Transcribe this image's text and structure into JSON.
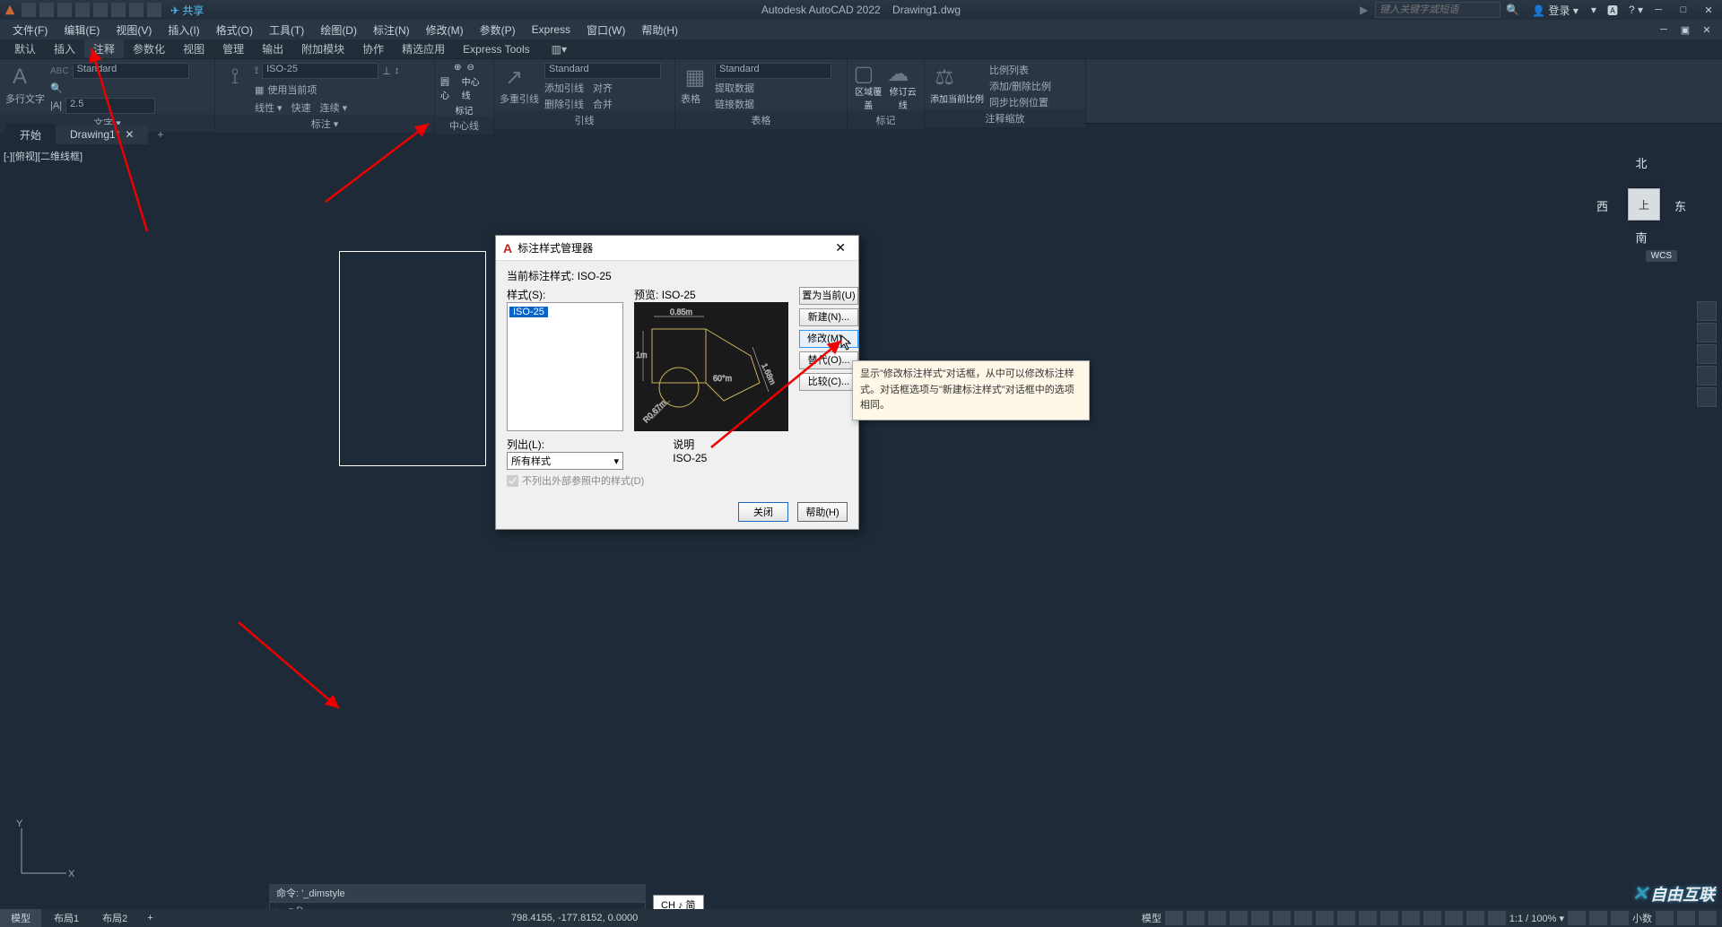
{
  "app": {
    "title": "Autodesk AutoCAD 2022",
    "file": "Drawing1.dwg",
    "share": "共享"
  },
  "search": {
    "placeholder": "键入关键字或短语",
    "login": "登录"
  },
  "menu": [
    "文件(F)",
    "编辑(E)",
    "视图(V)",
    "插入(I)",
    "格式(O)",
    "工具(T)",
    "绘图(D)",
    "标注(N)",
    "修改(M)",
    "参数(P)",
    "Express",
    "窗口(W)",
    "帮助(H)"
  ],
  "tabs": [
    "默认",
    "插入",
    "注释",
    "参数化",
    "视图",
    "管理",
    "输出",
    "附加模块",
    "协作",
    "精选应用",
    "Express Tools"
  ],
  "ribbon": {
    "text": {
      "big": "A",
      "label": "多行文字",
      "sel": "Standard",
      "num": "2.5",
      "panel": "文字 ▾"
    },
    "dim": {
      "sel": "ISO-25",
      "opt1": "使用当前项",
      "opt2": "线性 ▾",
      "opt3": "快速",
      "opt4": "连续 ▾",
      "panel": "标注 ▾"
    },
    "center": {
      "l1": "圆心",
      "l2": "标记",
      "l3": "中心线",
      "panel": "中心线"
    },
    "leader": {
      "sel": "Standard",
      "big": "多重引线",
      "o1": "添加引线",
      "o2": "删除引线",
      "o3": "对齐",
      "o4": "合并",
      "panel": "引线"
    },
    "table": {
      "sel": "Standard",
      "big": "表格",
      "o1": "提取数据",
      "o2": "链接数据",
      "panel": "表格"
    },
    "mark": {
      "b1": "区域覆盖",
      "b2": "修订云线",
      "panel": "标记"
    },
    "scale": {
      "big": "添加当前比例",
      "o1": "比例列表",
      "o2": "添加/删除比例",
      "o3": "同步比例位置",
      "panel": "注释缩放"
    }
  },
  "doctabs": {
    "start": "开始",
    "dwg": "Drawing1*"
  },
  "viewport": {
    "label": "[-][俯视][二维线框]"
  },
  "viewcube": {
    "n": "北",
    "s": "南",
    "e": "东",
    "w": "西",
    "top": "上",
    "wcs": "WCS"
  },
  "dialog": {
    "title": "标注样式管理器",
    "current_label": "当前标注样式:",
    "current": "ISO-25",
    "styles_label": "样式(S):",
    "style_item": "ISO-25",
    "preview_label": "预览:",
    "preview_name": "ISO-25",
    "preview_dims": {
      "top": "0.85m",
      "left": "1m",
      "diag": "1.68m",
      "ang": "60°m",
      "rad": "R0.67m"
    },
    "btns": {
      "set": "置为当前(U)",
      "new": "新建(N)...",
      "mod": "修改(M)...",
      "ovr": "替代(O)...",
      "cmp": "比较(C)..."
    },
    "list_label": "列出(L):",
    "list_sel": "所有样式",
    "chk": "不列出外部参照中的样式(D)",
    "desc_label": "说明",
    "desc": "ISO-25",
    "close": "关闭",
    "help": "帮助(H)"
  },
  "tooltip": "显示\"修改标注样式\"对话框，从中可以修改标注样式。对话框选项与\"新建标注样式\"对话框中的选项相同。",
  "cmd": {
    "hist": "命令: '_dimstyle",
    "prompt": "▸_ ▾ D"
  },
  "ime": "CH ♪ 简",
  "status": {
    "layouts": [
      "模型",
      "布局1",
      "布局2"
    ],
    "coords": "798.4155, -177.8152, 0.0000",
    "model": "模型",
    "scale": "1:1 / 100% ▾",
    "dec": "小数"
  },
  "watermark": "自由互联"
}
